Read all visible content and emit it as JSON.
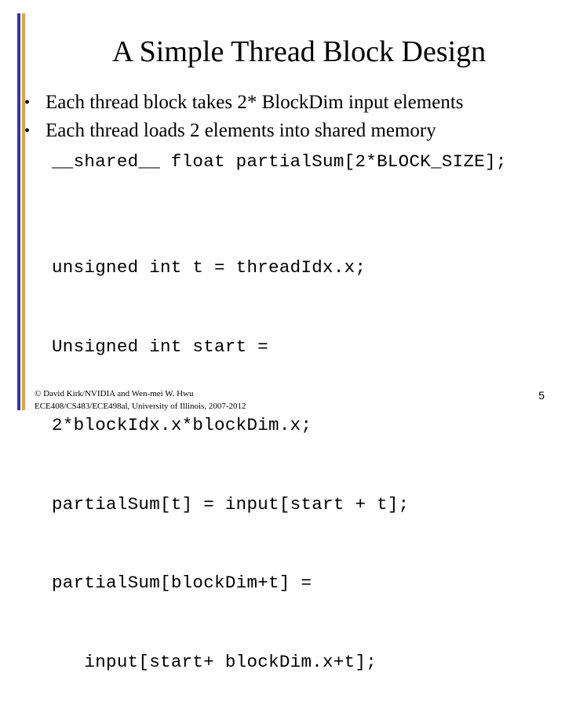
{
  "slide": {
    "title": "A Simple Thread Block Design",
    "bullets": [
      "Each thread block takes 2* BlockDim input elements",
      "Each thread loads 2 elements into shared memory"
    ],
    "bullet_glyph": "•",
    "shared_declaration": "__shared__ float partialSum[2*BLOCK_SIZE];",
    "code_lines": [
      "unsigned int t = threadIdx.x;",
      "Unsigned int start =",
      "2*blockIdx.x*blockDim.x;",
      "partialSum[t] = input[start + t];",
      "partialSum[blockDim+t] =",
      "   input[start+ blockDim.x+t];"
    ],
    "footer": {
      "line1": "© David Kirk/NVIDIA and Wen-mei W. Hwu",
      "line2": "ECE408/CS483/ECE498al, University of Illinois, 2007-2012"
    },
    "page_number": "5"
  },
  "colors": {
    "accent_bar_blue": "#3333bb",
    "accent_bar_orange": "#f0a020",
    "background": "#ffffff",
    "text": "#000000"
  }
}
